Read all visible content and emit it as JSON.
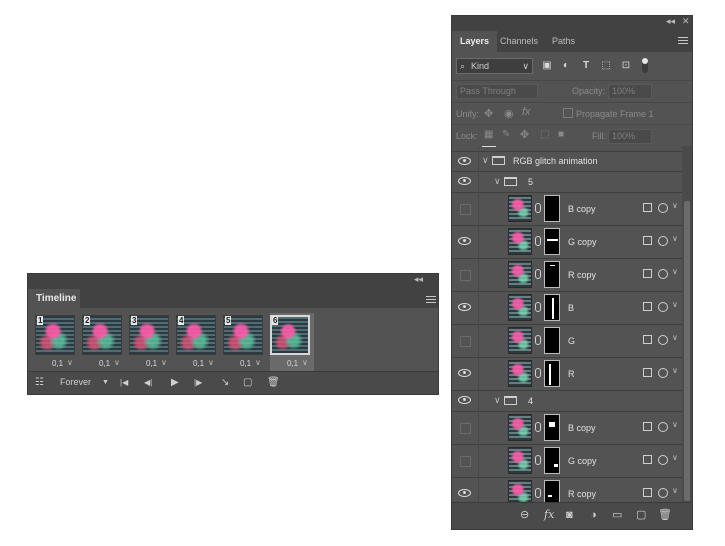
{
  "timeline": {
    "tab": "Timeline",
    "collapse": "◂◂",
    "frames": [
      {
        "number": "1",
        "duration": "0,1"
      },
      {
        "number": "2",
        "duration": "0,1"
      },
      {
        "number": "3",
        "duration": "0,1"
      },
      {
        "number": "4",
        "duration": "0,1"
      },
      {
        "number": "5",
        "duration": "0,1"
      },
      {
        "number": "6",
        "duration": "0,1"
      }
    ],
    "duration_arrow": "∨",
    "loop": "Forever",
    "loop_arrow": "▼",
    "icons": {
      "convert": "☷",
      "first": "|◀",
      "prev": "◀|",
      "play": "▶",
      "next": "|▶",
      "tween": "↘",
      "new_frame": "▢",
      "delete": "🗑"
    }
  },
  "layers": {
    "window_controls": {
      "collapse": "◂◂",
      "close": "✕"
    },
    "tabs": [
      "Layers",
      "Channels",
      "Paths"
    ],
    "filter": {
      "kind": "Kind",
      "search_glyph": "⌕",
      "arrow": "∨",
      "icons": {
        "image": "▣",
        "adjust": "◐",
        "type": "T",
        "shape": "⬚",
        "smart": "⊡"
      }
    },
    "blend_mode": "Pass Through",
    "opacity_label": "Opacity:",
    "opacity_value": "100%",
    "unify_label": "Unify:",
    "propagate_label": "Propagate Frame 1",
    "lock_label": "Lock:",
    "fill_label": "Fill:",
    "fill_value": "100%",
    "group_main": "RGB glitch animation",
    "groups": [
      {
        "name": "5",
        "layers": [
          {
            "name": "B copy",
            "visible": false
          },
          {
            "name": "G copy",
            "visible": true
          },
          {
            "name": "R copy",
            "visible": false
          },
          {
            "name": "B",
            "visible": true
          },
          {
            "name": "G",
            "visible": false
          },
          {
            "name": "R",
            "visible": true
          }
        ]
      },
      {
        "name": "4",
        "layers": [
          {
            "name": "B copy",
            "visible": false
          },
          {
            "name": "G copy",
            "visible": false
          },
          {
            "name": "R copy",
            "visible": true
          }
        ]
      }
    ],
    "bottom_icons": {
      "link": "⊖",
      "fx": "fx",
      "mask": "◙",
      "adjust": "◑",
      "folder": "▭",
      "new": "▢",
      "delete": "🗑"
    }
  }
}
